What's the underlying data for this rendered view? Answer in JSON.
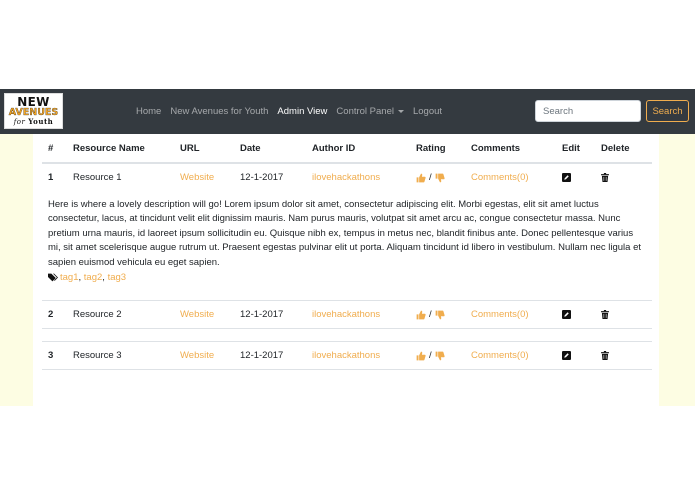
{
  "brand": {
    "line1": "NEW",
    "line2": "AVENUES",
    "line3_prefix": "for",
    "line3": "Youth"
  },
  "nav": {
    "home": "Home",
    "nay": "New Avenues for Youth",
    "admin": "Admin View",
    "control_panel": "Control Panel",
    "logout": "Logout"
  },
  "search": {
    "placeholder": "Search",
    "button": "Search"
  },
  "table": {
    "headers": {
      "num": "#",
      "name": "Resource Name",
      "url": "URL",
      "date": "Date",
      "author": "Author ID",
      "rating": "Rating",
      "comments": "Comments",
      "edit": "Edit",
      "delete": "Delete"
    },
    "rows": [
      {
        "num": "1",
        "name": "Resource 1",
        "url": "Website",
        "date": "12-1-2017",
        "author": "ilovehackathons",
        "sep": "/",
        "comments": "Comments(0)"
      },
      {
        "num": "2",
        "name": "Resource 2",
        "url": "Website",
        "date": "12-1-2017",
        "author": "ilovehackathons",
        "sep": "/",
        "comments": "Comments(0)"
      },
      {
        "num": "3",
        "name": "Resource 3",
        "url": "Website",
        "date": "12-1-2017",
        "author": "ilovehackathons",
        "sep": "/",
        "comments": "Comments(0)"
      }
    ],
    "description": "Here is where a lovely description will go! Lorem ipsum dolor sit amet, consectetur adipiscing elit. Morbi egestas, elit sit amet luctus consectetur, lacus, at tincidunt velit elit dignissim mauris. Nam purus mauris, volutpat sit amet arcu ac, congue consectetur massa. Nunc pretium urna mauris, id laoreet ipsum sollicitudin eu. Quisque nibh ex, tempus in metus nec, blandit finibus ante. Donec pellentesque varius mi, sit amet scelerisque augue rutrum ut. Praesent egestas pulvinar elit ut porta. Aliquam tincidunt id libero in vestibulum. Nullam nec ligula et sapien euismod vehicula eu eget sapien.",
    "tags": [
      "tag1",
      "tag2",
      "tag3"
    ],
    "tag_sep": ","
  },
  "colors": {
    "navbar": "#343a40",
    "accent": "#f0ad4e",
    "side_panel": "#fdfde3"
  },
  "icons": {
    "like": "thumbs-up-icon",
    "dislike": "thumbs-down-icon",
    "edit": "edit-icon",
    "delete": "trash-icon",
    "tag": "tags-icon"
  }
}
